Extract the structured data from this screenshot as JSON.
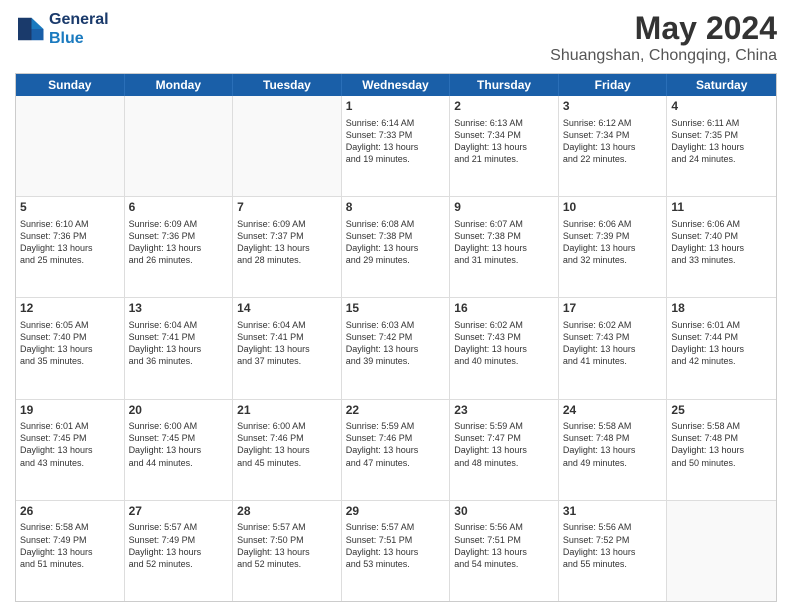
{
  "header": {
    "logo_line1": "General",
    "logo_line2": "Blue",
    "title": "May 2024",
    "subtitle": "Shuangshan, Chongqing, China"
  },
  "weekdays": [
    "Sunday",
    "Monday",
    "Tuesday",
    "Wednesday",
    "Thursday",
    "Friday",
    "Saturday"
  ],
  "rows": [
    [
      {
        "day": "",
        "lines": []
      },
      {
        "day": "",
        "lines": []
      },
      {
        "day": "",
        "lines": []
      },
      {
        "day": "1",
        "lines": [
          "Sunrise: 6:14 AM",
          "Sunset: 7:33 PM",
          "Daylight: 13 hours",
          "and 19 minutes."
        ]
      },
      {
        "day": "2",
        "lines": [
          "Sunrise: 6:13 AM",
          "Sunset: 7:34 PM",
          "Daylight: 13 hours",
          "and 21 minutes."
        ]
      },
      {
        "day": "3",
        "lines": [
          "Sunrise: 6:12 AM",
          "Sunset: 7:34 PM",
          "Daylight: 13 hours",
          "and 22 minutes."
        ]
      },
      {
        "day": "4",
        "lines": [
          "Sunrise: 6:11 AM",
          "Sunset: 7:35 PM",
          "Daylight: 13 hours",
          "and 24 minutes."
        ]
      }
    ],
    [
      {
        "day": "5",
        "lines": [
          "Sunrise: 6:10 AM",
          "Sunset: 7:36 PM",
          "Daylight: 13 hours",
          "and 25 minutes."
        ]
      },
      {
        "day": "6",
        "lines": [
          "Sunrise: 6:09 AM",
          "Sunset: 7:36 PM",
          "Daylight: 13 hours",
          "and 26 minutes."
        ]
      },
      {
        "day": "7",
        "lines": [
          "Sunrise: 6:09 AM",
          "Sunset: 7:37 PM",
          "Daylight: 13 hours",
          "and 28 minutes."
        ]
      },
      {
        "day": "8",
        "lines": [
          "Sunrise: 6:08 AM",
          "Sunset: 7:38 PM",
          "Daylight: 13 hours",
          "and 29 minutes."
        ]
      },
      {
        "day": "9",
        "lines": [
          "Sunrise: 6:07 AM",
          "Sunset: 7:38 PM",
          "Daylight: 13 hours",
          "and 31 minutes."
        ]
      },
      {
        "day": "10",
        "lines": [
          "Sunrise: 6:06 AM",
          "Sunset: 7:39 PM",
          "Daylight: 13 hours",
          "and 32 minutes."
        ]
      },
      {
        "day": "11",
        "lines": [
          "Sunrise: 6:06 AM",
          "Sunset: 7:40 PM",
          "Daylight: 13 hours",
          "and 33 minutes."
        ]
      }
    ],
    [
      {
        "day": "12",
        "lines": [
          "Sunrise: 6:05 AM",
          "Sunset: 7:40 PM",
          "Daylight: 13 hours",
          "and 35 minutes."
        ]
      },
      {
        "day": "13",
        "lines": [
          "Sunrise: 6:04 AM",
          "Sunset: 7:41 PM",
          "Daylight: 13 hours",
          "and 36 minutes."
        ]
      },
      {
        "day": "14",
        "lines": [
          "Sunrise: 6:04 AM",
          "Sunset: 7:41 PM",
          "Daylight: 13 hours",
          "and 37 minutes."
        ]
      },
      {
        "day": "15",
        "lines": [
          "Sunrise: 6:03 AM",
          "Sunset: 7:42 PM",
          "Daylight: 13 hours",
          "and 39 minutes."
        ]
      },
      {
        "day": "16",
        "lines": [
          "Sunrise: 6:02 AM",
          "Sunset: 7:43 PM",
          "Daylight: 13 hours",
          "and 40 minutes."
        ]
      },
      {
        "day": "17",
        "lines": [
          "Sunrise: 6:02 AM",
          "Sunset: 7:43 PM",
          "Daylight: 13 hours",
          "and 41 minutes."
        ]
      },
      {
        "day": "18",
        "lines": [
          "Sunrise: 6:01 AM",
          "Sunset: 7:44 PM",
          "Daylight: 13 hours",
          "and 42 minutes."
        ]
      }
    ],
    [
      {
        "day": "19",
        "lines": [
          "Sunrise: 6:01 AM",
          "Sunset: 7:45 PM",
          "Daylight: 13 hours",
          "and 43 minutes."
        ]
      },
      {
        "day": "20",
        "lines": [
          "Sunrise: 6:00 AM",
          "Sunset: 7:45 PM",
          "Daylight: 13 hours",
          "and 44 minutes."
        ]
      },
      {
        "day": "21",
        "lines": [
          "Sunrise: 6:00 AM",
          "Sunset: 7:46 PM",
          "Daylight: 13 hours",
          "and 45 minutes."
        ]
      },
      {
        "day": "22",
        "lines": [
          "Sunrise: 5:59 AM",
          "Sunset: 7:46 PM",
          "Daylight: 13 hours",
          "and 47 minutes."
        ]
      },
      {
        "day": "23",
        "lines": [
          "Sunrise: 5:59 AM",
          "Sunset: 7:47 PM",
          "Daylight: 13 hours",
          "and 48 minutes."
        ]
      },
      {
        "day": "24",
        "lines": [
          "Sunrise: 5:58 AM",
          "Sunset: 7:48 PM",
          "Daylight: 13 hours",
          "and 49 minutes."
        ]
      },
      {
        "day": "25",
        "lines": [
          "Sunrise: 5:58 AM",
          "Sunset: 7:48 PM",
          "Daylight: 13 hours",
          "and 50 minutes."
        ]
      }
    ],
    [
      {
        "day": "26",
        "lines": [
          "Sunrise: 5:58 AM",
          "Sunset: 7:49 PM",
          "Daylight: 13 hours",
          "and 51 minutes."
        ]
      },
      {
        "day": "27",
        "lines": [
          "Sunrise: 5:57 AM",
          "Sunset: 7:49 PM",
          "Daylight: 13 hours",
          "and 52 minutes."
        ]
      },
      {
        "day": "28",
        "lines": [
          "Sunrise: 5:57 AM",
          "Sunset: 7:50 PM",
          "Daylight: 13 hours",
          "and 52 minutes."
        ]
      },
      {
        "day": "29",
        "lines": [
          "Sunrise: 5:57 AM",
          "Sunset: 7:51 PM",
          "Daylight: 13 hours",
          "and 53 minutes."
        ]
      },
      {
        "day": "30",
        "lines": [
          "Sunrise: 5:56 AM",
          "Sunset: 7:51 PM",
          "Daylight: 13 hours",
          "and 54 minutes."
        ]
      },
      {
        "day": "31",
        "lines": [
          "Sunrise: 5:56 AM",
          "Sunset: 7:52 PM",
          "Daylight: 13 hours",
          "and 55 minutes."
        ]
      },
      {
        "day": "",
        "lines": []
      }
    ]
  ]
}
